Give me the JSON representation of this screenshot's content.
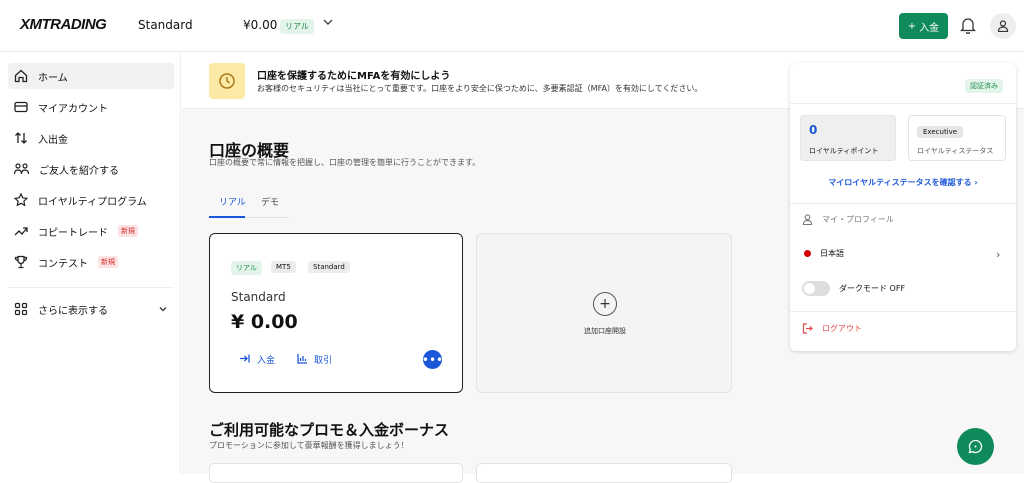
{
  "header": {
    "logo": "XMTRADING",
    "account_type": "Standard",
    "balance": "¥0.00",
    "account_badge": "リアル",
    "deposit_button": "入金"
  },
  "sidebar": {
    "items": [
      {
        "label": "ホーム",
        "icon": "home-icon",
        "active": true
      },
      {
        "label": "マイアカウント",
        "icon": "card-icon"
      },
      {
        "label": "入出金",
        "icon": "transfer-icon"
      },
      {
        "label": "ご友人を紹介する",
        "icon": "people-icon"
      },
      {
        "label": "ロイヤルティプログラム",
        "icon": "star-icon"
      },
      {
        "label": "コピートレード",
        "icon": "trend-icon",
        "badge": "新規"
      },
      {
        "label": "コンテスト",
        "icon": "trophy-icon",
        "badge": "新規"
      }
    ],
    "more": "さらに表示する"
  },
  "mfa_banner": {
    "title": "口座を保護するためにMFAを有効にしよう",
    "text": "お客様のセキュリティは当社にとって重要です。口座をより安全に保つために、多要素認証（MFA）を有効にしてください。"
  },
  "overview": {
    "title": "口座の概要",
    "subtitle": "口座の概要で常に情報を把握し、口座の管理を簡単に行うことができます。",
    "tabs": [
      "リアル",
      "デモ"
    ],
    "active_tab": "リアル"
  },
  "account_card": {
    "tags": [
      "リアル",
      "MT5",
      "Standard"
    ],
    "name": "Standard",
    "balance": "¥ 0.00",
    "deposit": "入金",
    "trade": "取引"
  },
  "add_account": {
    "label": "追加口座開設"
  },
  "promos": {
    "title": "ご利用可能なプロモ＆入金ボーナス",
    "subtitle": "プロモーションに参加して豪華報酬を獲得しましょう！"
  },
  "profile_panel": {
    "verified": "認証済み",
    "points_value": "0",
    "points_label": "ロイヤルティポイント",
    "status_value": "Executive",
    "status_label": "ロイヤルティステータス",
    "status_link": "マイロイヤルティステータスを確認する",
    "my_profile": "マイ・プロフィール",
    "language": "日本語",
    "dark_mode": "ダークモード OFF",
    "logout": "ログアウト"
  },
  "colors": {
    "brand_green": "#0f8a5b",
    "accent_blue": "#1b57d9",
    "danger_red": "#e14b4b"
  }
}
